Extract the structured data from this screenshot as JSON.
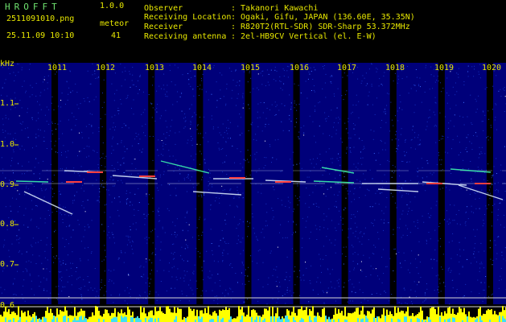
{
  "header": {
    "app_title": "HROFFT",
    "app_version": "1.0.0",
    "file_name": "2511091010.png",
    "meteor_label": "meteor",
    "datetime": "25.11.09 10:10",
    "meteor_count": "41",
    "info": [
      {
        "label": "Observer",
        "value": ": Takanori Kawachi"
      },
      {
        "label": "Receiving Location",
        "value": ": Ogaki, Gifu, JAPAN (136.60E, 35.35N)"
      },
      {
        "label": "Receiver",
        "value": ": R820T2(RTL-SDR) SDR-Sharp 53.372MHz"
      },
      {
        "label": "Receiving antenna",
        "value": ": 2el-HB9CV Vertical (el. E-W)"
      }
    ]
  },
  "spectrogram": {
    "y_unit": "kHz",
    "y_ticks": [
      "1.1",
      "1.0",
      "0.9",
      "0.8",
      "0.7",
      "0.6"
    ],
    "time_labels": [
      "1011",
      "1012",
      "1013",
      "1014",
      "1015",
      "1016",
      "1017",
      "1018",
      "1019",
      "1020"
    ],
    "colors": {
      "background": "#00007a",
      "label": "#e8e800",
      "echo_core": "#ff4040",
      "echo_mid": "#40ffb0",
      "echo_edge": "#e0f0ff",
      "level_yellow": "#ffff00",
      "level_cyan": "#40e0f0"
    }
  }
}
